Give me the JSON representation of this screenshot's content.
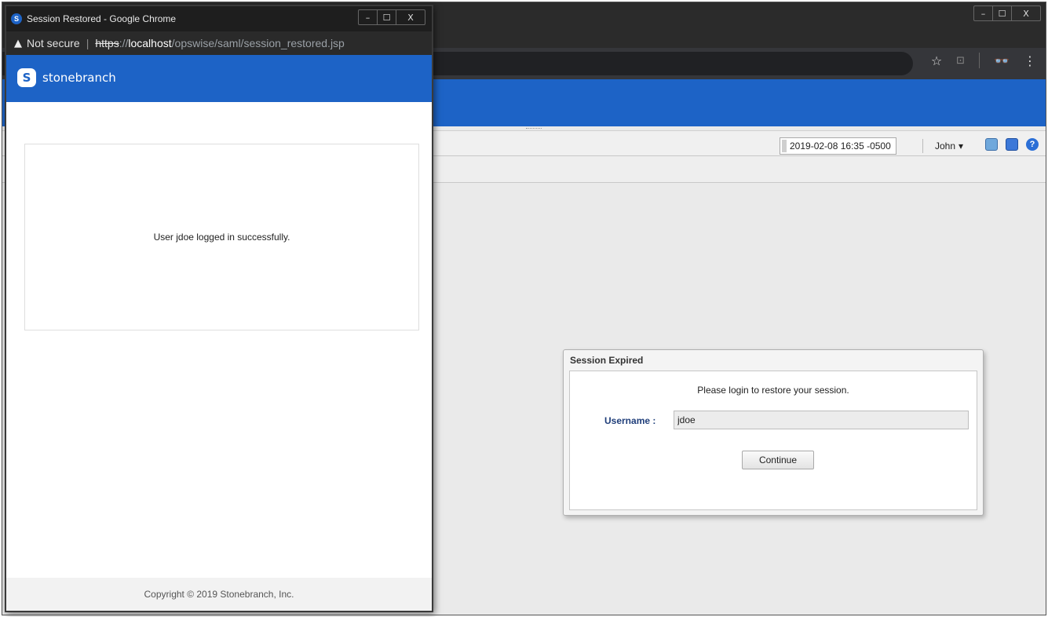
{
  "popup": {
    "window_title": "Session Restored - Google Chrome",
    "favicon_letter": "S",
    "address": {
      "warning": "Not secure",
      "separator": "|",
      "url_scheme": "https",
      "url_scheme_rest": "://",
      "url_host": "localhost",
      "url_path": "/opswise/saml/session_restored.jsp"
    },
    "brand": {
      "logo_letter": "S",
      "name": "stonebranch"
    },
    "message": "User jdoe logged in successfully.",
    "footer": "Copyright © 2019 Stonebranch, Inc.",
    "window_buttons": {
      "minimize": "–",
      "maximize": "☐",
      "close": "X"
    }
  },
  "main": {
    "window_buttons": {
      "minimize": "–",
      "maximize": "☐",
      "close": "X"
    },
    "datetime": "2019-02-08 16:35 -0500",
    "user": {
      "name": "John",
      "caret": "▾"
    },
    "dialog": {
      "title": "Session Expired",
      "message": "Please login to restore your session.",
      "username_label": "Username :",
      "username_value": "jdoe",
      "continue_label": "Continue"
    }
  },
  "icons": {
    "star": "star-icon",
    "cast": "cast-icon",
    "incognito": "incognito-icon",
    "more": "more-vert-icon",
    "warning": "warning-icon"
  },
  "colors": {
    "brand_blue": "#1d63c6",
    "label_blue": "#1f3e7a"
  }
}
